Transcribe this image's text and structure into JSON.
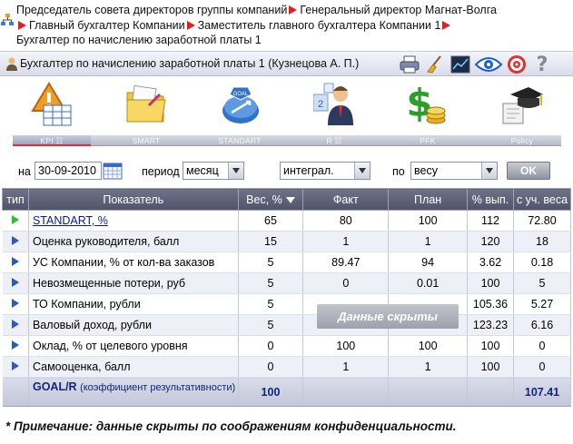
{
  "breadcrumb": {
    "items": [
      "Председатель совета директоров группы компаний",
      "Генеральный директор Магнат-Волга",
      "Главный бухгалтер Компании",
      "Заместитель главного бухгалтера Компании 1",
      "Бухгалтер по начислению заработной платы 1"
    ]
  },
  "titlebar": {
    "title": "Бухгалтер по начислению заработной платы 1  (Кузнецова А. П.)",
    "tools": [
      "printer-icon",
      "broom-icon",
      "chart-window-icon",
      "eye-icon",
      "target-icon",
      "help-icon"
    ],
    "help": "?"
  },
  "modules": [
    {
      "label": "KPI ☷",
      "icon": "kpi-warning-icon"
    },
    {
      "label": "SMART",
      "icon": "smart-folder-icon"
    },
    {
      "label": "STANDART",
      "icon": "standart-goal-icon"
    },
    {
      "label": "R ☷",
      "icon": "r-person-icon"
    },
    {
      "label": "PFK",
      "icon": "pfk-dollar-icon"
    },
    {
      "label": "Policy",
      "icon": "policy-graduation-icon"
    }
  ],
  "filters": {
    "date_label": "на",
    "date_value": "30-09-2010",
    "period_label": "период",
    "period_value": "месяц",
    "mode_value": "интеграл.",
    "sort_label": "по",
    "sort_value": "весу",
    "ok_label": "OK"
  },
  "table": {
    "headers": [
      "тип",
      "Показатель",
      "Вес, %",
      "Факт",
      "План",
      "% вып.",
      "с уч. веса"
    ],
    "rows": [
      {
        "type": "green",
        "name": "STANDART, %",
        "weight": "65",
        "fact": "80",
        "plan": "100",
        "pct": "112",
        "weighted": "72.80",
        "link": true
      },
      {
        "type": "blue",
        "name": "Оценка руководителя, балл",
        "weight": "15",
        "fact": "1",
        "plan": "1",
        "pct": "120",
        "weighted": "18"
      },
      {
        "type": "blue",
        "name": "УС Компании, % от кол-ва заказов",
        "weight": "5",
        "fact": "89.47",
        "plan": "94",
        "pct": "3.62",
        "weighted": "0.18"
      },
      {
        "type": "blue",
        "name": "Невозмещенные потери, руб",
        "weight": "5",
        "fact": "0",
        "plan": "0.01",
        "pct": "100",
        "weighted": "5"
      },
      {
        "type": "blue",
        "name": "ТО Компании, рубли",
        "weight": "5",
        "fact": "",
        "plan": "",
        "pct": "105.36",
        "weighted": "5.27"
      },
      {
        "type": "blue",
        "name": "Валовый доход, рубли",
        "weight": "5",
        "fact": "",
        "plan": "",
        "pct": "123.23",
        "weighted": "6.16"
      },
      {
        "type": "blue",
        "name": "Оклад, % от целевого уровня",
        "weight": "0",
        "fact": "100",
        "plan": "100",
        "pct": "100",
        "weighted": "0"
      },
      {
        "type": "blue",
        "name": "Самооценка, балл",
        "weight": "0",
        "fact": "1",
        "plan": "1",
        "pct": "100",
        "weighted": "0"
      }
    ],
    "footer": {
      "label": "GOAL/R",
      "sublabel": "(коэффициент результативности)",
      "weight": "100",
      "weighted": "107.41"
    }
  },
  "hidden_badge": "Данные скрыты",
  "note": "* Примечание: данные скрыты по соображениям конфиденциальности.",
  "colors": {
    "accent_red": "#e02020",
    "header": "#5a5f76",
    "link": "#0b1d80"
  }
}
